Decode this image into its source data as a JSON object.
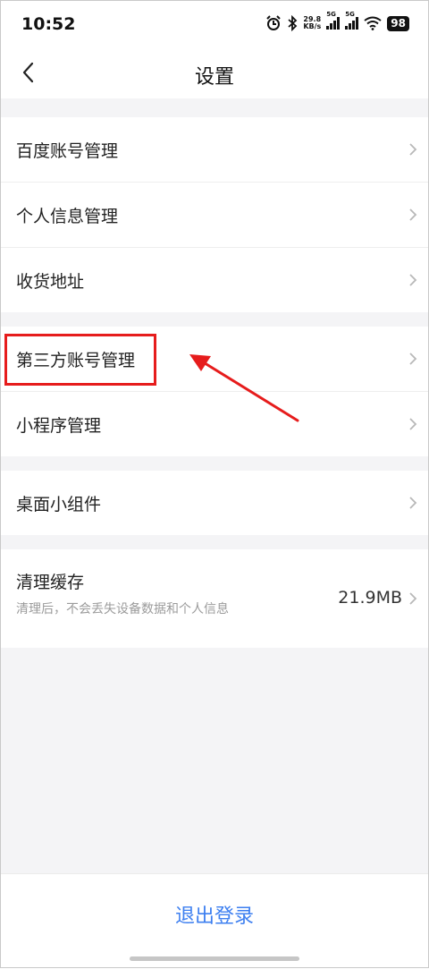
{
  "status_bar": {
    "time": "10:52",
    "net_speed_value": "29.8",
    "net_speed_unit": "KB/s",
    "signal1_label": "5G",
    "signal2_label": "5G",
    "battery": "98"
  },
  "header": {
    "title": "设置"
  },
  "groups": [
    {
      "items": [
        {
          "label": "百度账号管理"
        },
        {
          "label": "个人信息管理"
        },
        {
          "label": "收货地址"
        }
      ]
    },
    {
      "items": [
        {
          "label": "第三方账号管理"
        },
        {
          "label": "小程序管理"
        }
      ]
    },
    {
      "items": [
        {
          "label": "桌面小组件"
        }
      ]
    },
    {
      "items": [
        {
          "label": "清理缓存",
          "subtitle": "清理后，不会丢失设备数据和个人信息",
          "value": "21.9MB"
        }
      ]
    }
  ],
  "footer": {
    "logout_label": "退出登录"
  },
  "colors": {
    "accent": "#3d7ff0",
    "annotation": "#e61c1c"
  }
}
